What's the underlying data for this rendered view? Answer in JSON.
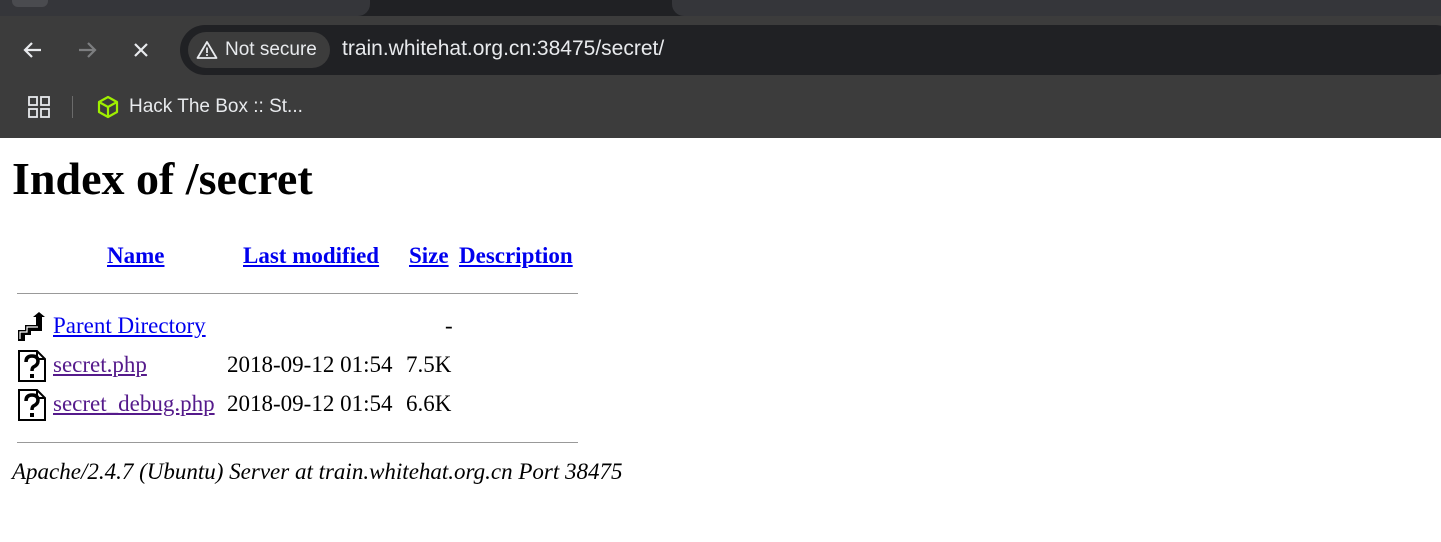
{
  "browser": {
    "security_label": "Not secure",
    "url": "train.whitehat.org.cn:38475/secret/",
    "bookmarks": [
      {
        "label": "Hack The Box :: St...",
        "icon": "hackthebox-cube-icon",
        "color": "#9fef00"
      }
    ]
  },
  "page": {
    "title": "Index of /secret",
    "columns": {
      "name": "Name",
      "last_modified": "Last modified",
      "size": "Size",
      "description": "Description"
    },
    "rows": [
      {
        "name": "Parent Directory",
        "last_modified": "",
        "size": "-",
        "icon": "parent-directory-icon"
      },
      {
        "name": "secret.php",
        "last_modified": "2018-09-12 01:54",
        "size": "7.5K",
        "icon": "unknown-file-icon"
      },
      {
        "name": "secret_debug.php",
        "last_modified": "2018-09-12 01:54",
        "size": "6.6K",
        "icon": "unknown-file-icon"
      }
    ],
    "address": "Apache/2.4.7 (Ubuntu) Server at train.whitehat.org.cn Port 38475"
  },
  "colors": {
    "link": "#0000ee",
    "visited_link": "#551a8b",
    "chrome_bg": "#3c3c3c"
  }
}
